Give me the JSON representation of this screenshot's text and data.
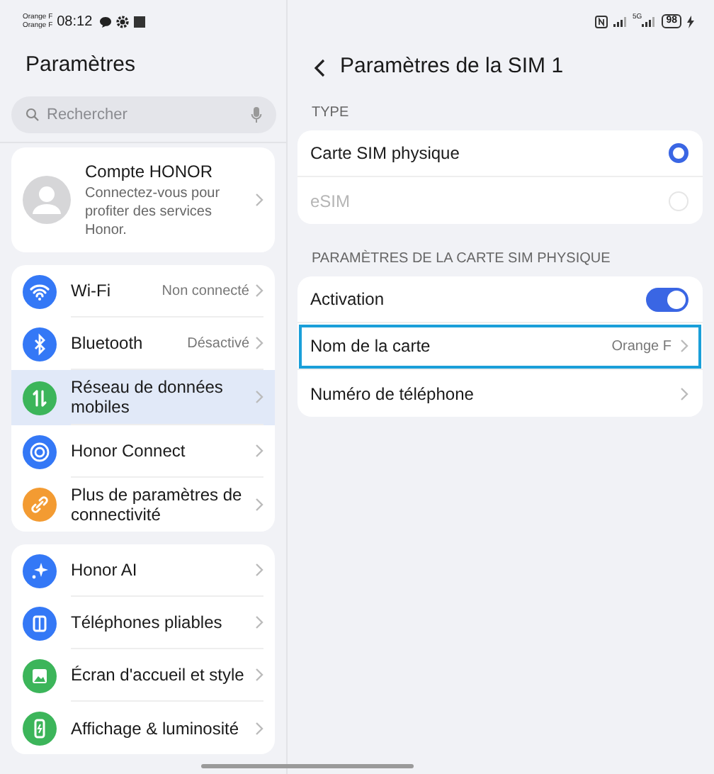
{
  "status_bar": {
    "carriers": [
      "Orange F",
      "Orange F"
    ],
    "time": "08:12",
    "network_label": "5G",
    "battery": "98"
  },
  "settings": {
    "title": "Paramètres",
    "search": {
      "placeholder": "Rechercher"
    },
    "account": {
      "name": "Compte HONOR",
      "subtitle": "Connectez-vous pour profiter des services Honor."
    },
    "groups": [
      {
        "items": [
          {
            "kind": "wifi",
            "label": "Wi-Fi",
            "value": "Non connecté",
            "color": "#3478f6",
            "selected": false
          },
          {
            "kind": "bluetooth",
            "label": "Bluetooth",
            "value": "Désactivé",
            "color": "#3478f6",
            "selected": false
          },
          {
            "kind": "data",
            "label": "Réseau de données mobiles",
            "color": "#3cb55a",
            "selected": true
          },
          {
            "kind": "connect",
            "label": "Honor Connect",
            "color": "#3478f6",
            "selected": false
          },
          {
            "kind": "link",
            "label": "Plus de paramètres de connectivité",
            "color": "#f39b32",
            "selected": false
          }
        ]
      },
      {
        "items": [
          {
            "kind": "ai",
            "label": "Honor AI",
            "color": "#3478f6",
            "selected": false
          },
          {
            "kind": "fold",
            "label": "Téléphones pliables",
            "color": "#3478f6",
            "selected": false
          },
          {
            "kind": "image",
            "label": "Écran d'accueil et style",
            "color": "#3cb55a",
            "selected": false
          },
          {
            "kind": "display",
            "label": "Affichage & luminosité",
            "color": "#3cb55a",
            "selected": false
          }
        ]
      }
    ]
  },
  "sim": {
    "title": "Paramètres de la SIM 1",
    "sections": [
      {
        "header": "TYPE",
        "rows": [
          {
            "kind": "radio",
            "label": "Carte SIM physique",
            "selected": true,
            "disabled": false,
            "focused": false
          },
          {
            "kind": "radio",
            "label": "eSIM",
            "selected": false,
            "disabled": true,
            "focused": false
          }
        ]
      },
      {
        "header": "PARAMÈTRES DE LA CARTE SIM PHYSIQUE",
        "rows": [
          {
            "kind": "toggle",
            "label": "Activation",
            "on": true,
            "focused": false
          },
          {
            "kind": "link",
            "label": "Nom de la carte",
            "value": "Orange F",
            "focused": true
          },
          {
            "kind": "link",
            "label": "Numéro de téléphone",
            "focused": false
          }
        ]
      }
    ]
  }
}
